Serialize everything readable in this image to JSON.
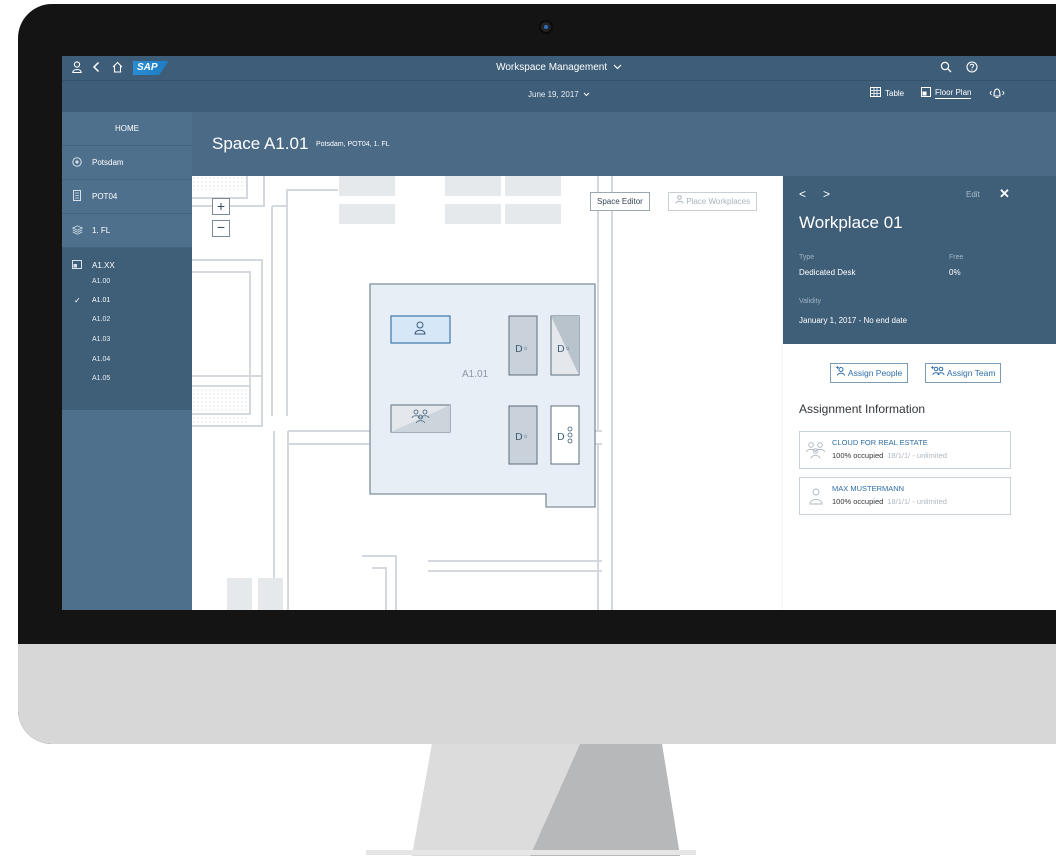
{
  "shell": {
    "app_title": "Workspace Management",
    "date": "June 19, 2017",
    "view_table": "Table",
    "view_floor_plan": "Floor Plan",
    "logo": "SAP"
  },
  "sidebar": {
    "home": "HOME",
    "site": "Potsdam",
    "building": "POT04",
    "floor": "1. FL",
    "group": "A1.XX",
    "spaces": [
      "A1.00",
      "A1.01",
      "A1.02",
      "A1.03",
      "A1.04",
      "A1.05"
    ],
    "selected_space": "A1.01",
    "check_mark": "✓"
  },
  "header": {
    "title": "Space A1.01",
    "subtitle": "Potsdam, POT04, 1. FL"
  },
  "floor_plan": {
    "zoom_in": "+",
    "zoom_out": "−",
    "space_editor": "Space Editor",
    "place_workplaces": "Place Workplaces",
    "room_label": "A1.01"
  },
  "details": {
    "prev": "<",
    "next": ">",
    "edit": "Edit",
    "close": "✕",
    "title": "Workplace 01",
    "type_label": "Type",
    "type_value": "Dedicated Desk",
    "free_label": "Free",
    "free_value": "0%",
    "validity_label": "Validity",
    "validity_value": "January 1, 2017 - No end date",
    "assign_people": "Assign People",
    "assign_team": "Assign Team",
    "assignment_heading": "Assignment Information",
    "assignments": [
      {
        "name": "CLOUD FOR REAL ESTATE",
        "occupancy": "100% occupied",
        "period": "18/1/1/ - unlimited"
      },
      {
        "name": "MAX MUSTERMANN",
        "occupancy": "100% occupied",
        "period": "18/1/1/ - unlimited"
      }
    ]
  },
  "colors": {
    "shell": "#3d5d78",
    "sidebar": "#4f708c",
    "header": "#4a6a86",
    "selected_desk": "#d6e8f7",
    "link": "#2d6ea6"
  }
}
